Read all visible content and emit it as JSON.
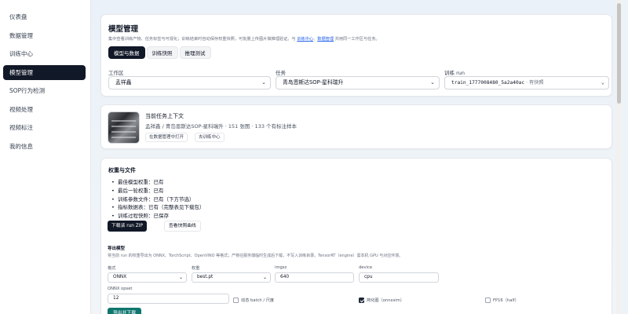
{
  "sidebar": {
    "items": [
      {
        "label": "仪表盘",
        "active": false
      },
      {
        "label": "数据管理",
        "active": false
      },
      {
        "label": "训练中心",
        "active": false
      },
      {
        "label": "模型管理",
        "active": true
      },
      {
        "label": "SOP行为检测",
        "active": false
      },
      {
        "label": "视频处理",
        "active": false
      },
      {
        "label": "视频标注",
        "active": false
      },
      {
        "label": "我的信息",
        "active": false
      }
    ]
  },
  "header": {
    "title": "模型管理",
    "desc_pre": "集中查看训练产物、任务标签与可视化；训练结束时自动保存权重快照，可批量上传图片做推理验证。与 ",
    "link1": "训练中心",
    "desc_mid": "、",
    "link2": "数据管理",
    "desc_post": " 共用同一工作区与任务。",
    "tabs": [
      "模型与数据",
      "训练快照",
      "推理测试"
    ]
  },
  "filters": {
    "workspace_label": "工作区",
    "workspace_value": "孟祥鑫",
    "task_label": "任务",
    "task_value": "青岛恩斯达SOP-星科瑞升",
    "run_label": "训练 run",
    "run_value": "train_1777008480_5a2a40ac",
    "run_suffix": " · 有快照"
  },
  "context": {
    "title": "当前任务上下文",
    "subtitle": "孟祥鑫 / 青岛恩斯达SOP-星科瑞升 · 151 张图 · 133 个有标注样本",
    "btn_open": "在数据管理中打开",
    "btn_train": "去训练中心"
  },
  "weights": {
    "title": "权重与文件",
    "items": [
      "最佳模型权重：已有",
      "最后一轮权重：已有",
      "训练参数文件：已有（下方节选）",
      "指标数据表：已有（完整表见下载包）",
      "训练过程快照：已保存"
    ],
    "btn_download": "下载该 run ZIP",
    "btn_curves": "查看快照曲线"
  },
  "export": {
    "title": "导出模型",
    "desc": "将当前 run 的权重导出为 ONNX、TorchScript、OpenVINO 等格式；产物在服务端临时生成后下载，不写入训练目录。TensorRT（engine）需本机 GPU 与对应环境。",
    "format_label": "格式",
    "format_value": "ONNX",
    "weight_label": "权重",
    "weight_value": "best.pt",
    "imgsz_label": "imgsz",
    "imgsz_value": "640",
    "device_label": "device",
    "device_value": "cpu",
    "opset_label": "ONNX opset",
    "opset_value": "12",
    "opt_dynamic": "动态 batch / 尺度",
    "opt_simplify": "简化图（onnxsim）",
    "opt_fp16": "FP16（half）",
    "btn_export": "导出并下载"
  }
}
